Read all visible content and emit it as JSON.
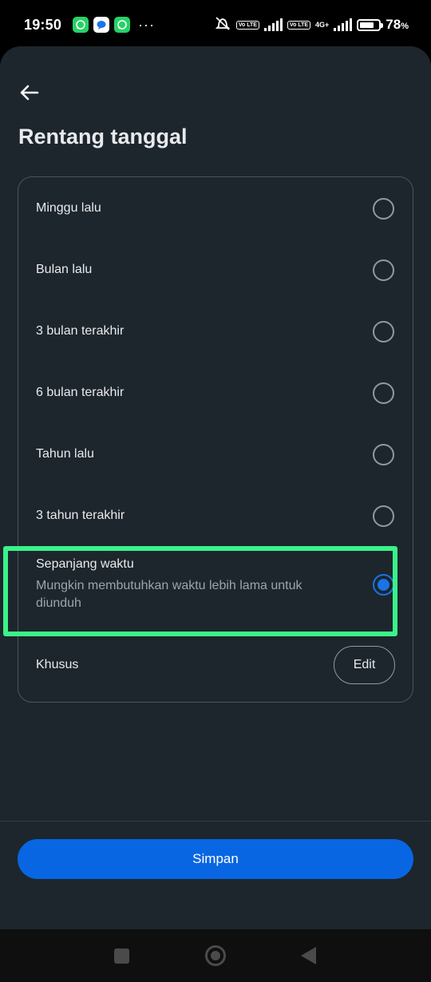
{
  "status_bar": {
    "time": "19:50",
    "more": "···",
    "lte_badge": "Vo LTE",
    "network": "4G+",
    "battery_level": 0.78,
    "battery_text": "78",
    "battery_unit": "%"
  },
  "header": {
    "back_icon": "arrow-left-icon",
    "title": "Rentang tanggal"
  },
  "options": [
    {
      "label": "Minggu lalu",
      "selected": false
    },
    {
      "label": "Bulan lalu",
      "selected": false
    },
    {
      "label": "3 bulan terakhir",
      "selected": false
    },
    {
      "label": "6 bulan terakhir",
      "selected": false
    },
    {
      "label": "Tahun lalu",
      "selected": false
    },
    {
      "label": "3 tahun terakhir",
      "selected": false
    },
    {
      "label": "Sepanjang waktu",
      "sublabel": "Mungkin membutuhkan waktu lebih lama untuk diunduh",
      "selected": true
    },
    {
      "label": "Khusus",
      "action_label": "Edit"
    }
  ],
  "footer": {
    "save_label": "Simpan"
  },
  "colors": {
    "background": "#1d262c",
    "accent": "#0866e3",
    "radio_selected": "#1a73e8",
    "highlight": "#3af28b"
  }
}
